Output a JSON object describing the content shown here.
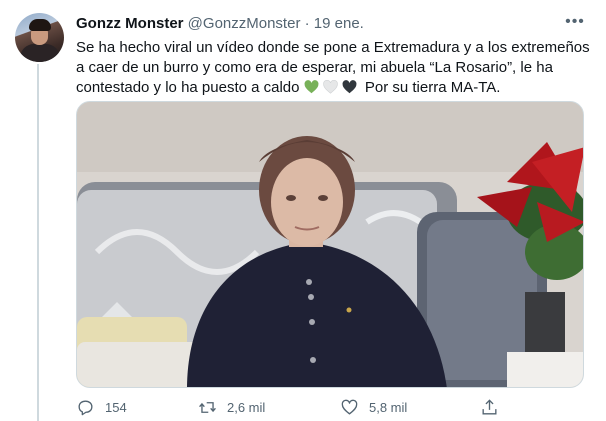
{
  "tweet": {
    "author_name": "Gonzz Monster",
    "handle": "@GonzzMonster",
    "separator": "·",
    "date": "19 ene.",
    "text_main": "Se ha hecho viral un vídeo donde se pone a Extremadura y a los extremeños a caer de un burro y como era de esperar, mi abuela “La Rosario”, le ha contestado y lo ha puesto a caldo",
    "text_tail": "Por su tierra MA-TA.",
    "hearts": [
      {
        "name": "green-heart",
        "color": "#78b159"
      },
      {
        "name": "white-heart",
        "color": "#e6e7e8"
      },
      {
        "name": "black-heart",
        "color": "#31373d"
      }
    ],
    "more_icon": "ellipsis-icon"
  },
  "actions": {
    "reply": {
      "icon": "reply-icon",
      "count": "154"
    },
    "retweet": {
      "icon": "retweet-icon",
      "count": "2,6 mil"
    },
    "like": {
      "icon": "heart-outline-icon",
      "count": "5,8 mil"
    },
    "share": {
      "icon": "share-icon",
      "count": ""
    }
  },
  "colors": {
    "secondary_text": "#536471",
    "primary_text": "#0f1419",
    "thread_line": "#cfd9de"
  }
}
